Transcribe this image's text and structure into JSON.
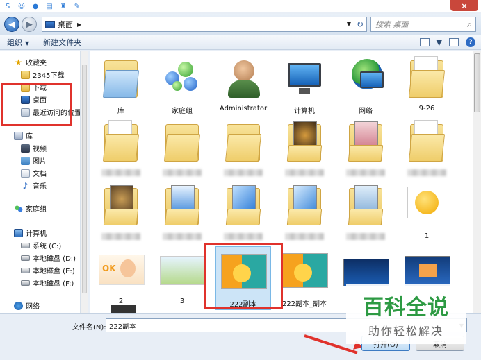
{
  "titlebar": {
    "close_label": "×",
    "quick_icons": [
      "s-icon",
      "smiley-icon",
      "mic-icon",
      "keyboard-icon",
      "shirt-icon",
      "wrench-icon"
    ]
  },
  "address": {
    "location": "桌面",
    "search_placeholder": "搜索 桌面"
  },
  "toolbar": {
    "organize": "组织",
    "new_folder": "新建文件夹"
  },
  "nav": {
    "favorites": "收藏夹",
    "fav_items": [
      "2345下载",
      "下载",
      "桌面",
      "最近访问的位置"
    ],
    "libraries": "库",
    "lib_items": [
      "视频",
      "图片",
      "文档",
      "音乐"
    ],
    "homegroup": "家庭组",
    "computer": "计算机",
    "drives": [
      "系统 (C:)",
      "本地磁盘 (D:)",
      "本地磁盘 (E:)",
      "本地磁盘 (F:)"
    ],
    "network": "网络"
  },
  "files": {
    "row1": [
      "库",
      "家庭组",
      "Administrator",
      "计算机",
      "网络",
      "9-26"
    ],
    "emoji_label": "1",
    "row4": [
      "2",
      "3",
      "222副本",
      "222副本_副本"
    ]
  },
  "footer": {
    "filename_label": "文件名(N):",
    "filename_value": "222副本",
    "open_label": "打开(O)",
    "cancel_label": "取消"
  },
  "watermark": {
    "title": "百科全说",
    "subtitle": "助你轻松解决"
  },
  "colors": {
    "highlight_red": "#e0322c",
    "selection_blue": "#cce4f7",
    "watermark_green": "#2d9a43"
  }
}
